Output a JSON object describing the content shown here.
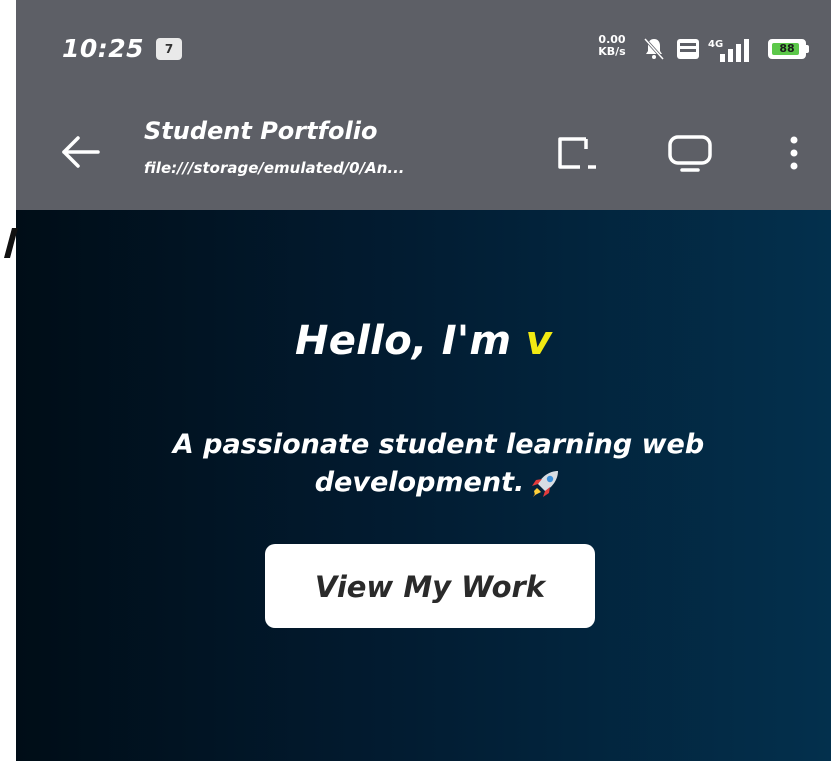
{
  "status_bar": {
    "time": "10:25",
    "notification_badge": "7",
    "net_speed_value": "0.00",
    "net_speed_unit": "KB/s",
    "network_type": "4G",
    "battery": "88",
    "battery_level": 0.88
  },
  "app_bar": {
    "title": "Student Portfolio",
    "url": "file:///storage/emulated/0/An..."
  },
  "hero": {
    "greeting": "Hello, I'm ",
    "name": "v",
    "subtitle": "A passionate student learning web development.",
    "cta_label": "View My Work"
  },
  "colors": {
    "bar": "#5d5f66",
    "accent_name": "#f2ea12",
    "bg_dark": "#000d17",
    "bg_light": "#03304d"
  }
}
